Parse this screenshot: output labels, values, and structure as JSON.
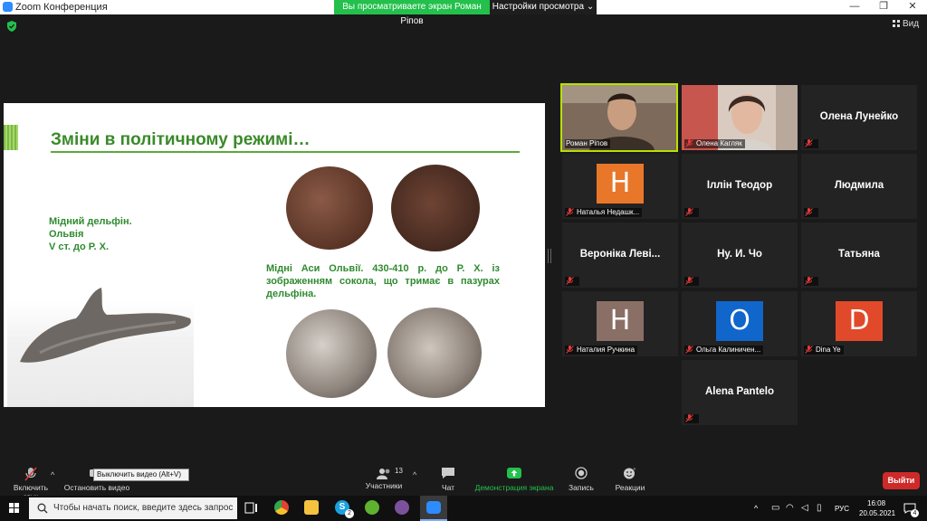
{
  "window": {
    "title": "Zoom Конференция"
  },
  "share": {
    "banner": "Вы просматриваете экран Роман Ріпов",
    "view_settings": "Настройки просмотра ⌄"
  },
  "header": {
    "view_label": "Вид"
  },
  "slide": {
    "title": "Зміни в політичному режимі…",
    "dolphin_caption": [
      "Мідний дельфін.",
      "Ольвія",
      "V ст. до Р. Х."
    ],
    "coins_caption": "Мідні Аси Ольвії. 430-410 р. до Р. Х. із зображенням сокола, що тримає в пазурах дельфіна."
  },
  "participants": [
    {
      "name": "Роман Ріпов",
      "kind": "video"
    },
    {
      "name": "Олена Кагляк",
      "kind": "video"
    },
    {
      "name": "Олена Лунейко",
      "kind": "name"
    },
    {
      "name": "Наталья Недашк...",
      "kind": "avatar",
      "letter": "H",
      "color": "#e8772a"
    },
    {
      "name": "Іллін Теодор",
      "kind": "name"
    },
    {
      "name": "Людмила",
      "kind": "name"
    },
    {
      "name": "Вероніка Леві...",
      "kind": "name"
    },
    {
      "name": "Ну. И. Чо",
      "kind": "name"
    },
    {
      "name": "Татьяна",
      "kind": "name"
    },
    {
      "name": "Наталия Ручкина",
      "kind": "avatar",
      "letter": "H",
      "color": "#8a6f66"
    },
    {
      "name": "Ольга Калиничен...",
      "kind": "avatar",
      "letter": "O",
      "color": "#1166cc"
    },
    {
      "name": "Dina Ye",
      "kind": "avatar",
      "letter": "D",
      "color": "#e04a2a"
    },
    {
      "name": "Alena Pantelo",
      "kind": "name"
    }
  ],
  "toolbar": {
    "unmute": "Включить звук",
    "stop_video": "Остановить видео",
    "tooltip": "Выключить видео (Alt+V)",
    "participants": "Участники",
    "participants_count": "13",
    "chat": "Чат",
    "share_screen": "Демонстрация экрана",
    "record": "Запись",
    "reactions": "Реакции",
    "leave": "Выйти"
  },
  "taskbar": {
    "search_placeholder": "Чтобы начать поиск, введите здесь запрос",
    "language": "РУС",
    "time": "16:08",
    "date": "20.05.2021",
    "skype_badge": "2",
    "notifications": "4"
  }
}
